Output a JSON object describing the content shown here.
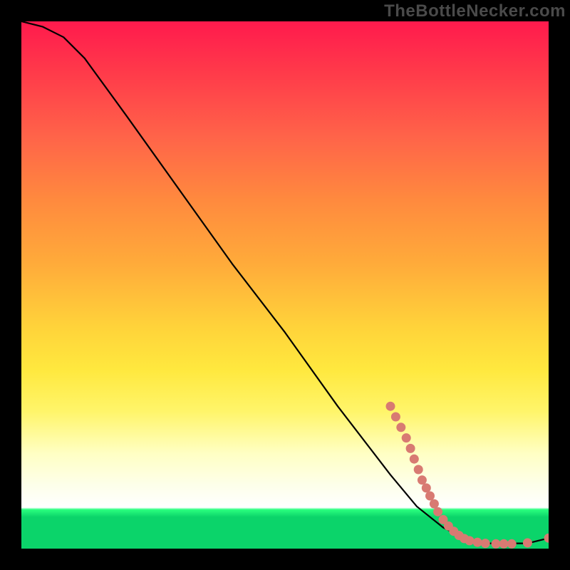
{
  "watermark": "TheBottleNecker.com",
  "chart_data": {
    "type": "line",
    "title": "",
    "xlabel": "",
    "ylabel": "",
    "xlim": [
      0,
      100
    ],
    "ylim": [
      0,
      100
    ],
    "series": [
      {
        "name": "curve",
        "x": [
          0,
          4,
          8,
          12,
          20,
          30,
          40,
          50,
          60,
          70,
          75,
          80,
          84,
          88,
          92,
          96,
          100
        ],
        "y": [
          100,
          99,
          97,
          93,
          82,
          68,
          54,
          41,
          27,
          14,
          8,
          4,
          2,
          1,
          1,
          1,
          2
        ]
      }
    ],
    "scatter_points": {
      "name": "markers",
      "color": "#d87a72",
      "points": [
        {
          "x": 70,
          "y": 27
        },
        {
          "x": 71,
          "y": 25
        },
        {
          "x": 72,
          "y": 23
        },
        {
          "x": 73,
          "y": 21
        },
        {
          "x": 73.8,
          "y": 19
        },
        {
          "x": 74.5,
          "y": 17
        },
        {
          "x": 75.3,
          "y": 15
        },
        {
          "x": 76,
          "y": 13
        },
        {
          "x": 76.8,
          "y": 11.5
        },
        {
          "x": 77.5,
          "y": 10
        },
        {
          "x": 78.3,
          "y": 8.5
        },
        {
          "x": 79,
          "y": 7
        },
        {
          "x": 80,
          "y": 5.5
        },
        {
          "x": 81,
          "y": 4.3
        },
        {
          "x": 82,
          "y": 3.3
        },
        {
          "x": 83,
          "y": 2.5
        },
        {
          "x": 84,
          "y": 1.9
        },
        {
          "x": 85,
          "y": 1.5
        },
        {
          "x": 86.5,
          "y": 1.2
        },
        {
          "x": 88,
          "y": 1.0
        },
        {
          "x": 90,
          "y": 0.9
        },
        {
          "x": 91.5,
          "y": 0.9
        },
        {
          "x": 93,
          "y": 0.9
        },
        {
          "x": 96,
          "y": 1.1
        },
        {
          "x": 100,
          "y": 2.0
        }
      ]
    }
  }
}
